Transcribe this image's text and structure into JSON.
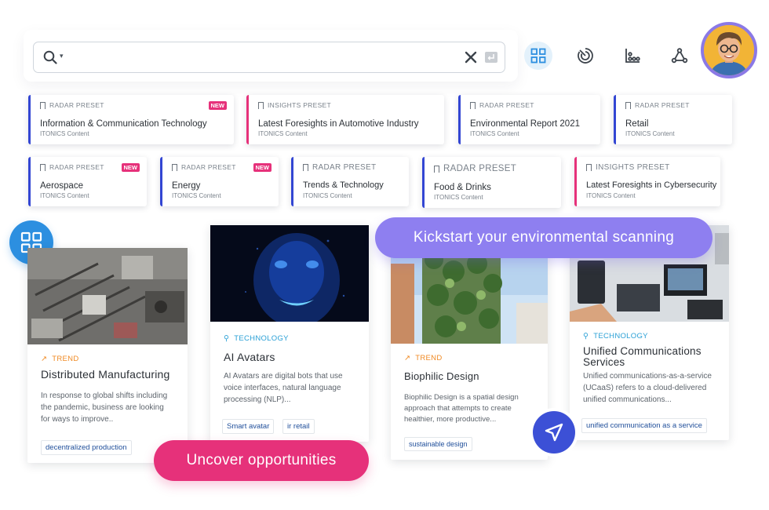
{
  "search": {
    "value": "",
    "placeholder": ""
  },
  "toolbar": {
    "views": [
      {
        "icon": "grid-view-icon",
        "active": true
      },
      {
        "icon": "radar-view-icon",
        "active": false
      },
      {
        "icon": "chart-view-icon",
        "active": false
      },
      {
        "icon": "network-view-icon",
        "active": false
      }
    ]
  },
  "presets": [
    {
      "type": "RADAR PRESET",
      "title": "Information & Communication Technology",
      "subtitle": "ITONICS Content",
      "new": "NEW",
      "accent": "#3346d3"
    },
    {
      "type": "INSIGHTS PRESET",
      "title": "Latest Foresights in Automotive Industry",
      "subtitle": "ITONICS Content",
      "new": "",
      "accent": "#e6317a"
    },
    {
      "type": "RADAR PRESET",
      "title": "Environmental Report 2021",
      "subtitle": "ITONICS Content",
      "new": "",
      "accent": "#3346d3"
    },
    {
      "type": "RADAR PRESET",
      "title": "Retail",
      "subtitle": "ITONICS Content",
      "new": "",
      "accent": "#3346d3"
    },
    {
      "type": "RADAR PRESET",
      "title": "Aerospace",
      "subtitle": "ITONICS Content",
      "new": "NEW",
      "accent": "#3346d3"
    },
    {
      "type": "RADAR PRESET",
      "title": "Energy",
      "subtitle": "ITONICS Content",
      "new": "NEW",
      "accent": "#3346d3"
    },
    {
      "type": "RADAR PRESET",
      "title": "Trends & Technology",
      "subtitle": "ITONICS Content",
      "new": "",
      "accent": "#3346d3"
    },
    {
      "type": "RADAR PRESET",
      "title": "Food & Drinks",
      "subtitle": "ITONICS Content",
      "new": "",
      "accent": "#3346d3"
    },
    {
      "type": "INSIGHTS PRESET",
      "title": "Latest Foresights in Cybersecurity",
      "subtitle": "ITONICS Content",
      "new": "",
      "accent": "#e6317a"
    }
  ],
  "cards": [
    {
      "type": "TREND",
      "title": "Distributed Manufacturing",
      "desc": [
        "In response to global shifts including",
        "the pandemic, business are looking",
        "for ways to improve.."
      ],
      "tags": [
        "decentralized production"
      ]
    },
    {
      "type": "TECHNOLOGY",
      "title": "AI Avatars",
      "desc": [
        "AI Avatars are digital bots that use",
        "voice interfaces, natural language",
        "processing (NLP)..."
      ],
      "tags": [
        "Smart avatar",
        "ir retail"
      ]
    },
    {
      "type": "TREND",
      "title": "Biophilic Design",
      "desc": [
        "Biophilic Design is a spatial design",
        "approach that attempts to create",
        "healthier, more productive..."
      ],
      "tags": [
        "sustainable design"
      ]
    },
    {
      "type": "TECHNOLOGY",
      "title_lines": [
        "Unified Communications",
        "Services"
      ],
      "desc": [
        "Unified communications-as-a-service",
        "(UCaaS) refers to a cloud-delivered",
        "unified communications..."
      ],
      "tags": [
        "unified communication as a service"
      ]
    }
  ],
  "callouts": {
    "kickstart": "Kickstart your environmental scanning",
    "uncover": "Uncover opportunities"
  },
  "colors": {
    "radar_accent": "#3346d3",
    "insights_accent": "#e6317a",
    "trend": "#f08a24",
    "technology": "#2aa0d6",
    "purple_pill": "#8e7ff0"
  }
}
